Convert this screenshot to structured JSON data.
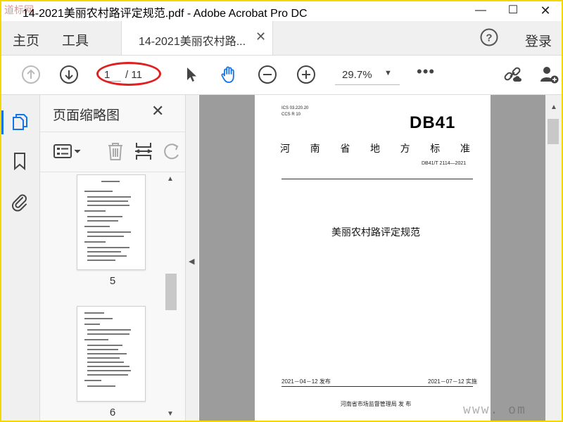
{
  "window": {
    "title": "14-2021美丽农村路评定规范.pdf - Adobe Acrobat Pro DC",
    "watermark_left": "道标网",
    "minimize": "—",
    "maximize": "☐",
    "close": "✕"
  },
  "menubar": {
    "home": "主页",
    "tools": "工具",
    "tab_label": "14-2021美丽农村路...",
    "tab_close": "✕",
    "help": "?",
    "login": "登录"
  },
  "toolbar": {
    "page_current": "1",
    "page_total": "/ 11",
    "zoom": "29.7%",
    "zoom_caret": "▼",
    "more": "•••"
  },
  "thumbnail_panel": {
    "title": "页面缩略图",
    "close": "✕",
    "thumbs": [
      {
        "label": "5"
      },
      {
        "label": "6"
      }
    ]
  },
  "document": {
    "ics": "ICS  03.220.20",
    "ccs": "CCS  R 10",
    "db_code": "DB41",
    "standard_chars": [
      "河",
      "南",
      "省",
      "地",
      "方",
      "标",
      "准"
    ],
    "number": "DB41/T 2114—2021",
    "title": "美丽农村路评定规范",
    "publish": "2021－04－12 发布",
    "implement": "2021－07－12 实施",
    "issuer": "河南省市场监督管理局    发 布"
  },
  "watermark_right": "www.      om"
}
